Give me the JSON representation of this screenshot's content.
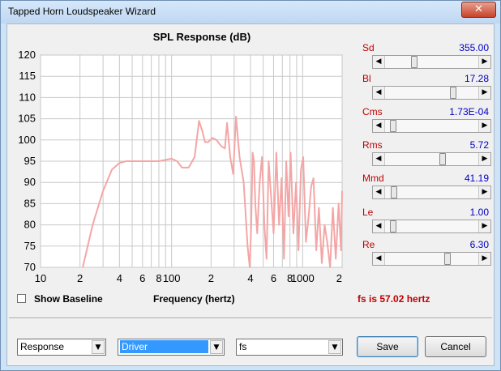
{
  "window": {
    "title": "Tapped Horn Loudspeaker Wizard",
    "close_glyph": "✕"
  },
  "chart_data": {
    "type": "line",
    "title": "SPL Response (dB)",
    "xlabel": "Frequency (hertz)",
    "ylabel": "",
    "xscale": "log",
    "xlim": [
      10,
      2000
    ],
    "ylim": [
      70,
      120
    ],
    "yticks": [
      70,
      75,
      80,
      85,
      90,
      95,
      100,
      105,
      110,
      115,
      120
    ],
    "xtick_labels": [
      {
        "value": 10,
        "label": "10"
      },
      {
        "value": 20,
        "label": "2"
      },
      {
        "value": 40,
        "label": "4"
      },
      {
        "value": 60,
        "label": "6"
      },
      {
        "value": 80,
        "label": "8"
      },
      {
        "value": 100,
        "label": "100"
      },
      {
        "value": 200,
        "label": "2"
      },
      {
        "value": 400,
        "label": "4"
      },
      {
        "value": 600,
        "label": "6"
      },
      {
        "value": 800,
        "label": "8"
      },
      {
        "value": 1000,
        "label": "1000"
      },
      {
        "value": 2000,
        "label": "2"
      }
    ],
    "grid": true,
    "series": [
      {
        "color": "#f4a6a6",
        "x": [
          21,
          25,
          30,
          35,
          40,
          45,
          50,
          60,
          70,
          80,
          90,
          100,
          110,
          120,
          135,
          150,
          162,
          172,
          180,
          190,
          205,
          220,
          240,
          255,
          265,
          280,
          295,
          310,
          330,
          355,
          380,
          395,
          405,
          415,
          425,
          435,
          450,
          470,
          490,
          510,
          530,
          550,
          570,
          600,
          630,
          660,
          690,
          720,
          750,
          780,
          810,
          850,
          890,
          930,
          970,
          1010,
          1060,
          1110,
          1160,
          1210,
          1270,
          1330,
          1400,
          1470,
          1540,
          1620,
          1700,
          1790,
          1880,
          1960,
          2000
        ],
        "y": [
          70,
          80,
          88,
          93,
          94.6,
          95,
          95,
          95,
          95,
          95,
          95.3,
          95.6,
          95,
          93.5,
          93.5,
          96,
          104.5,
          102,
          99.5,
          99.5,
          100.5,
          100,
          98.5,
          98,
          104,
          96,
          92,
          105.5,
          96,
          90,
          75,
          70,
          80,
          97,
          95,
          85,
          78,
          90,
          96,
          80,
          72,
          95,
          88,
          78,
          97,
          80,
          91,
          72,
          95,
          82,
          97,
          78,
          90,
          74,
          93,
          96,
          76,
          82,
          89,
          91,
          74,
          84,
          71,
          80,
          76,
          70,
          84,
          72,
          85,
          74,
          88
        ]
      }
    ]
  },
  "params": [
    {
      "label": "Sd",
      "value": "355.00",
      "level": 0.3
    },
    {
      "label": "Bl",
      "value": "17.28",
      "level": 0.75
    },
    {
      "label": "Cms",
      "value": "1.73E-04",
      "level": 0.06
    },
    {
      "label": "Rms",
      "value": "5.72",
      "level": 0.63
    },
    {
      "label": "Mmd",
      "value": "41.19",
      "level": 0.07
    },
    {
      "label": "Le",
      "value": "1.00",
      "level": 0.06
    },
    {
      "label": "Re",
      "value": "6.30",
      "level": 0.68
    }
  ],
  "scroll_left_glyph": "◀",
  "scroll_right_glyph": "▶",
  "dropdown_glyph": "▼",
  "show_baseline": {
    "label": "Show Baseline",
    "checked": false
  },
  "status": {
    "fs_text": "fs is 57.02 hertz"
  },
  "bottom": {
    "combo1": "Response",
    "combo2": "Driver",
    "combo3": "fs",
    "save_label": "Save",
    "cancel_label": "Cancel"
  }
}
